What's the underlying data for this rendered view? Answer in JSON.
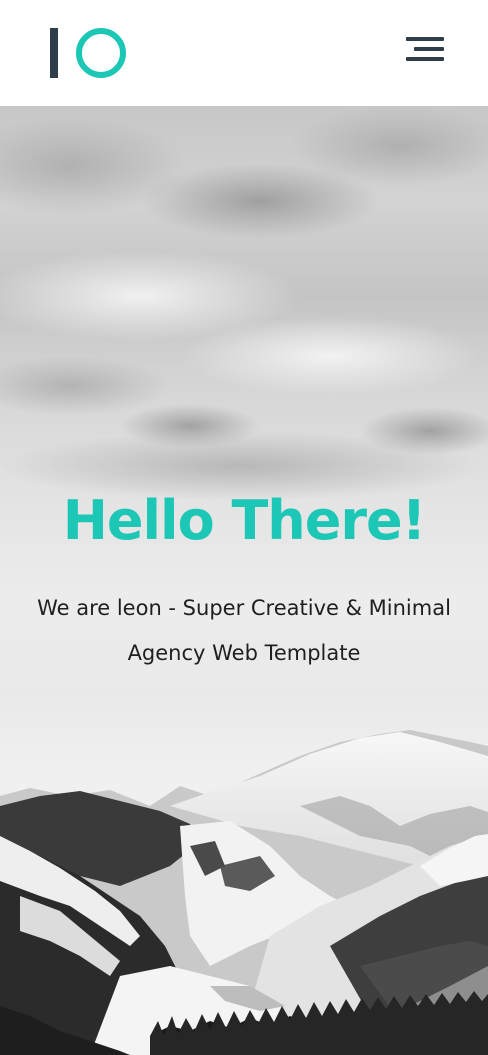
{
  "header": {
    "logo_icon": "io-logo-icon",
    "menu_icon": "hamburger-menu-icon"
  },
  "hero": {
    "title": "Hello There!",
    "subtitle_line1": "We are leon - Super Creative & Minimal",
    "subtitle_line2": "Agency Web Template",
    "background": "snowy-mountains-photo",
    "accent_color": "#1cc7b6",
    "dark_color": "#2d3e4a"
  }
}
